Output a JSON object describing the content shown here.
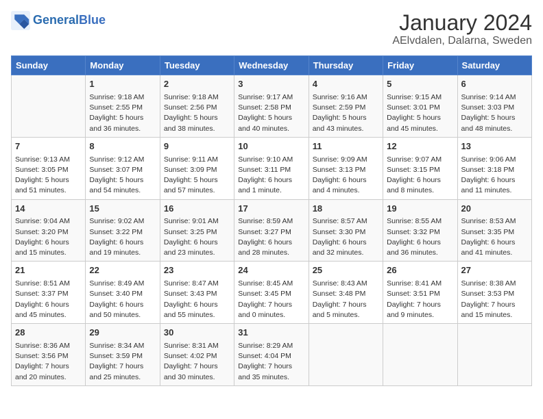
{
  "header": {
    "logo_general": "General",
    "logo_blue": "Blue",
    "title": "January 2024",
    "subtitle": "AElvdalen, Dalarna, Sweden"
  },
  "weekdays": [
    "Sunday",
    "Monday",
    "Tuesday",
    "Wednesday",
    "Thursday",
    "Friday",
    "Saturday"
  ],
  "weeks": [
    [
      {
        "day": "",
        "info": ""
      },
      {
        "day": "1",
        "info": "Sunrise: 9:18 AM\nSunset: 2:55 PM\nDaylight: 5 hours\nand 36 minutes."
      },
      {
        "day": "2",
        "info": "Sunrise: 9:18 AM\nSunset: 2:56 PM\nDaylight: 5 hours\nand 38 minutes."
      },
      {
        "day": "3",
        "info": "Sunrise: 9:17 AM\nSunset: 2:58 PM\nDaylight: 5 hours\nand 40 minutes."
      },
      {
        "day": "4",
        "info": "Sunrise: 9:16 AM\nSunset: 2:59 PM\nDaylight: 5 hours\nand 43 minutes."
      },
      {
        "day": "5",
        "info": "Sunrise: 9:15 AM\nSunset: 3:01 PM\nDaylight: 5 hours\nand 45 minutes."
      },
      {
        "day": "6",
        "info": "Sunrise: 9:14 AM\nSunset: 3:03 PM\nDaylight: 5 hours\nand 48 minutes."
      }
    ],
    [
      {
        "day": "7",
        "info": "Sunrise: 9:13 AM\nSunset: 3:05 PM\nDaylight: 5 hours\nand 51 minutes."
      },
      {
        "day": "8",
        "info": "Sunrise: 9:12 AM\nSunset: 3:07 PM\nDaylight: 5 hours\nand 54 minutes."
      },
      {
        "day": "9",
        "info": "Sunrise: 9:11 AM\nSunset: 3:09 PM\nDaylight: 5 hours\nand 57 minutes."
      },
      {
        "day": "10",
        "info": "Sunrise: 9:10 AM\nSunset: 3:11 PM\nDaylight: 6 hours\nand 1 minute."
      },
      {
        "day": "11",
        "info": "Sunrise: 9:09 AM\nSunset: 3:13 PM\nDaylight: 6 hours\nand 4 minutes."
      },
      {
        "day": "12",
        "info": "Sunrise: 9:07 AM\nSunset: 3:15 PM\nDaylight: 6 hours\nand 8 minutes."
      },
      {
        "day": "13",
        "info": "Sunrise: 9:06 AM\nSunset: 3:18 PM\nDaylight: 6 hours\nand 11 minutes."
      }
    ],
    [
      {
        "day": "14",
        "info": "Sunrise: 9:04 AM\nSunset: 3:20 PM\nDaylight: 6 hours\nand 15 minutes."
      },
      {
        "day": "15",
        "info": "Sunrise: 9:02 AM\nSunset: 3:22 PM\nDaylight: 6 hours\nand 19 minutes."
      },
      {
        "day": "16",
        "info": "Sunrise: 9:01 AM\nSunset: 3:25 PM\nDaylight: 6 hours\nand 23 minutes."
      },
      {
        "day": "17",
        "info": "Sunrise: 8:59 AM\nSunset: 3:27 PM\nDaylight: 6 hours\nand 28 minutes."
      },
      {
        "day": "18",
        "info": "Sunrise: 8:57 AM\nSunset: 3:30 PM\nDaylight: 6 hours\nand 32 minutes."
      },
      {
        "day": "19",
        "info": "Sunrise: 8:55 AM\nSunset: 3:32 PM\nDaylight: 6 hours\nand 36 minutes."
      },
      {
        "day": "20",
        "info": "Sunrise: 8:53 AM\nSunset: 3:35 PM\nDaylight: 6 hours\nand 41 minutes."
      }
    ],
    [
      {
        "day": "21",
        "info": "Sunrise: 8:51 AM\nSunset: 3:37 PM\nDaylight: 6 hours\nand 45 minutes."
      },
      {
        "day": "22",
        "info": "Sunrise: 8:49 AM\nSunset: 3:40 PM\nDaylight: 6 hours\nand 50 minutes."
      },
      {
        "day": "23",
        "info": "Sunrise: 8:47 AM\nSunset: 3:43 PM\nDaylight: 6 hours\nand 55 minutes."
      },
      {
        "day": "24",
        "info": "Sunrise: 8:45 AM\nSunset: 3:45 PM\nDaylight: 7 hours\nand 0 minutes."
      },
      {
        "day": "25",
        "info": "Sunrise: 8:43 AM\nSunset: 3:48 PM\nDaylight: 7 hours\nand 5 minutes."
      },
      {
        "day": "26",
        "info": "Sunrise: 8:41 AM\nSunset: 3:51 PM\nDaylight: 7 hours\nand 9 minutes."
      },
      {
        "day": "27",
        "info": "Sunrise: 8:38 AM\nSunset: 3:53 PM\nDaylight: 7 hours\nand 15 minutes."
      }
    ],
    [
      {
        "day": "28",
        "info": "Sunrise: 8:36 AM\nSunset: 3:56 PM\nDaylight: 7 hours\nand 20 minutes."
      },
      {
        "day": "29",
        "info": "Sunrise: 8:34 AM\nSunset: 3:59 PM\nDaylight: 7 hours\nand 25 minutes."
      },
      {
        "day": "30",
        "info": "Sunrise: 8:31 AM\nSunset: 4:02 PM\nDaylight: 7 hours\nand 30 minutes."
      },
      {
        "day": "31",
        "info": "Sunrise: 8:29 AM\nSunset: 4:04 PM\nDaylight: 7 hours\nand 35 minutes."
      },
      {
        "day": "",
        "info": ""
      },
      {
        "day": "",
        "info": ""
      },
      {
        "day": "",
        "info": ""
      }
    ]
  ]
}
